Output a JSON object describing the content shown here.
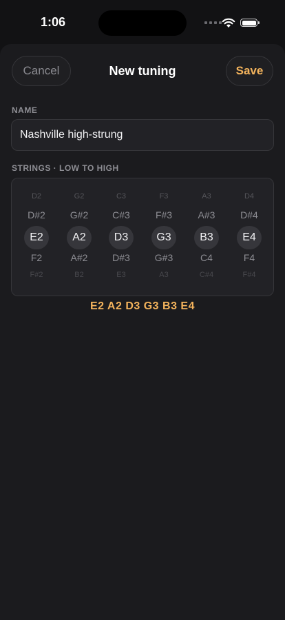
{
  "status_bar": {
    "time": "1:06"
  },
  "nav": {
    "cancel_label": "Cancel",
    "title": "New tuning",
    "save_label": "Save"
  },
  "name_section": {
    "label": "NAME",
    "value": "Nashville high-strung"
  },
  "strings_section": {
    "label": "STRINGS · LOW TO HIGH",
    "columns": [
      {
        "notes": [
          "D2",
          "D#2",
          "E2",
          "F2",
          "F#2"
        ]
      },
      {
        "notes": [
          "G2",
          "G#2",
          "A2",
          "A#2",
          "B2"
        ]
      },
      {
        "notes": [
          "C3",
          "C#3",
          "D3",
          "D#3",
          "E3"
        ]
      },
      {
        "notes": [
          "F3",
          "F#3",
          "G3",
          "G#3",
          "A3"
        ]
      },
      {
        "notes": [
          "A3",
          "A#3",
          "B3",
          "C4",
          "C#4"
        ]
      },
      {
        "notes": [
          "D4",
          "D#4",
          "E4",
          "F4",
          "F#4"
        ]
      }
    ],
    "summary": "E2 A2 D3 G3 B3 E4"
  },
  "colors": {
    "accent": "#f3b35c",
    "background": "#121214",
    "sheet": "#1b1b1e"
  }
}
